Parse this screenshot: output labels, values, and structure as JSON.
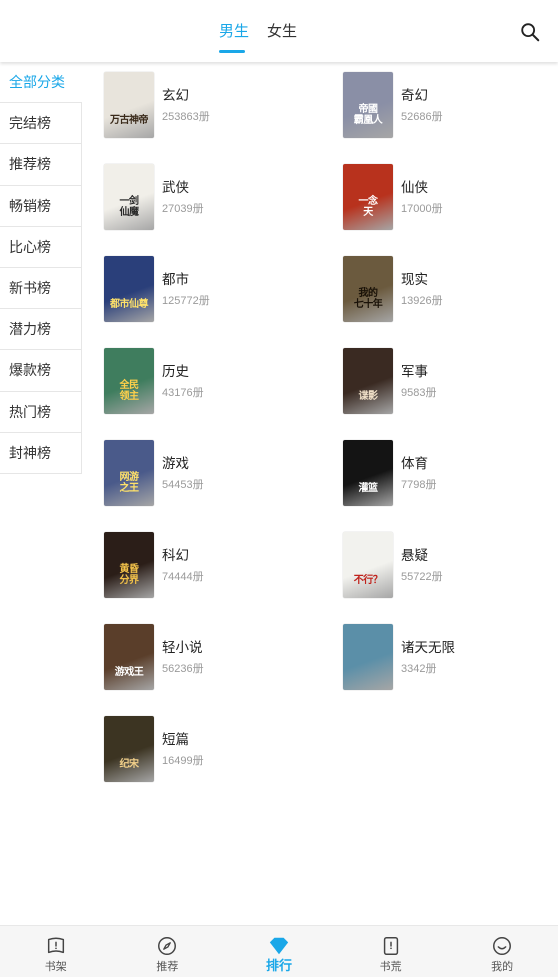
{
  "header": {
    "tabs": [
      {
        "label": "男生",
        "active": true
      },
      {
        "label": "女生",
        "active": false
      }
    ],
    "search_icon": "search-icon"
  },
  "sidebar": {
    "items": [
      {
        "label": "全部分类",
        "active": true
      },
      {
        "label": "完结榜"
      },
      {
        "label": "推荐榜"
      },
      {
        "label": "畅销榜"
      },
      {
        "label": "比心榜"
      },
      {
        "label": "新书榜"
      },
      {
        "label": "潜力榜"
      },
      {
        "label": "爆款榜"
      },
      {
        "label": "热门榜"
      },
      {
        "label": "封神榜"
      }
    ]
  },
  "categories": [
    {
      "name": "玄幻",
      "count": "253863册",
      "cover_text": "万古神帝",
      "bg": "#e8e4dc",
      "fg": "#3a2a1a"
    },
    {
      "name": "奇幻",
      "count": "52686册",
      "cover_text": "帝國\n霸凰人",
      "bg": "#8a8fa6",
      "fg": "#ffffff"
    },
    {
      "name": "武侠",
      "count": "27039册",
      "cover_text": "一剑\n仙魔",
      "bg": "#f1efe9",
      "fg": "#2a2a2a"
    },
    {
      "name": "仙侠",
      "count": "17000册",
      "cover_text": "一念\n天",
      "bg": "#b8321d",
      "fg": "#ffffff"
    },
    {
      "name": "都市",
      "count": "125772册",
      "cover_text": "都市仙尊",
      "bg": "#2a3f7a",
      "fg": "#ffe26a"
    },
    {
      "name": "现实",
      "count": "13926册",
      "cover_text": "我的\n七十年",
      "bg": "#6b5a3e",
      "fg": "#1a1208"
    },
    {
      "name": "历史",
      "count": "43176册",
      "cover_text": "全民\n领主",
      "bg": "#3f7d5e",
      "fg": "#ffd04a"
    },
    {
      "name": "军事",
      "count": "9583册",
      "cover_text": "谍影",
      "bg": "#3a2a22",
      "fg": "#f0e0c8"
    },
    {
      "name": "游戏",
      "count": "54453册",
      "cover_text": "网游\n之王",
      "bg": "#4a5a8a",
      "fg": "#ffe26a"
    },
    {
      "name": "体育",
      "count": "7798册",
      "cover_text": "灌篮",
      "bg": "#141414",
      "fg": "#ffffff"
    },
    {
      "name": "科幻",
      "count": "74444册",
      "cover_text": "黄昏\n分界",
      "bg": "#2b1e18",
      "fg": "#f2c24a"
    },
    {
      "name": "悬疑",
      "count": "55722册",
      "cover_text": "不行？",
      "bg": "#f2f2ee",
      "fg": "#c0221c"
    },
    {
      "name": "轻小说",
      "count": "56236册",
      "cover_text": "游戏王",
      "bg": "#5a3e2a",
      "fg": "#ffffff"
    },
    {
      "name": "诸天无限",
      "count": "3342册",
      "cover_text": "",
      "bg": "#5b8fa8",
      "fg": "#ffffff"
    },
    {
      "name": "短篇",
      "count": "16499册",
      "cover_text": "纪宋",
      "bg": "#3c3422",
      "fg": "#f2d08a"
    }
  ],
  "bottom_nav": [
    {
      "label": "书架",
      "icon": "bookshelf-icon",
      "active": false
    },
    {
      "label": "推荐",
      "icon": "compass-icon",
      "active": false
    },
    {
      "label": "排行",
      "icon": "ranking-diamond-icon",
      "active": true
    },
    {
      "label": "书荒",
      "icon": "book-icon",
      "active": false
    },
    {
      "label": "我的",
      "icon": "smiley-icon",
      "active": false
    }
  ],
  "colors": {
    "accent": "#1aa7e8",
    "text": "#222222",
    "muted": "#9a9a9a"
  }
}
